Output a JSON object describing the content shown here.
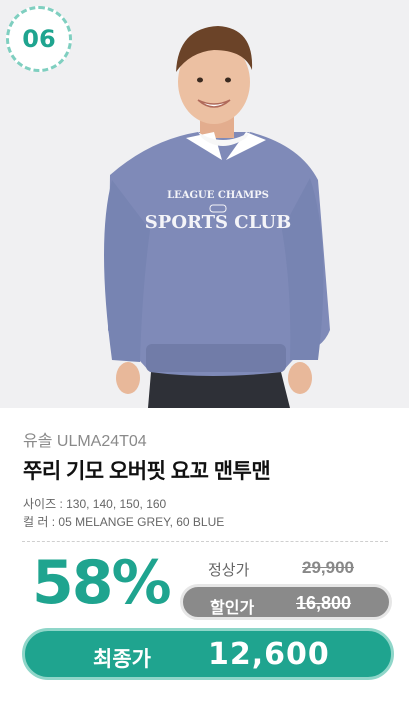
{
  "badge": {
    "number": "06"
  },
  "photo": {
    "print_top": "LEAGUE CHAMPS",
    "print_main": "SPORTS CLUB"
  },
  "product": {
    "brand": "유솔 ULMA24T04",
    "name": "쭈리 기모 오버핏 요꼬 맨투맨",
    "sizes": "사이즈 : 130, 140, 150, 160",
    "colors": "컬    러 : 05 MELANGE GREY, 60 BLUE"
  },
  "pricing": {
    "discount_rate": "58%",
    "regular_label": "정상가",
    "regular_price": "29,900",
    "sale_label": "할인가",
    "sale_price": "16,800",
    "final_label": "최종가",
    "final_price": "12,600"
  },
  "colors": {
    "accent": "#1fa48f",
    "accent_light": "#8fd6c9",
    "sweatshirt": "#7f8ab8",
    "sale_pill": "#8a8a8a"
  }
}
